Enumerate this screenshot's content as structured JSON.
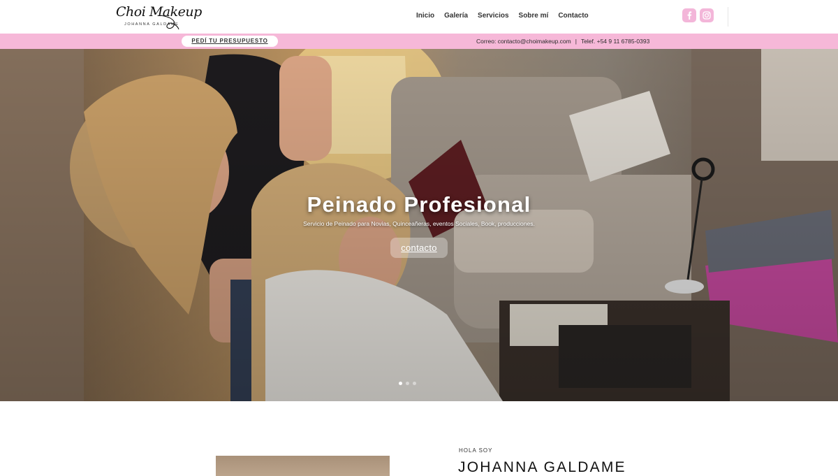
{
  "header": {
    "logo_text": "Choi Makeup",
    "logo_sub": "JOHANNA GALDAME",
    "nav": [
      "Inicio",
      "Galería",
      "Servicios",
      "Sobre mí",
      "Contacto"
    ]
  },
  "social": {
    "facebook_icon": "facebook-icon",
    "instagram_icon": "instagram-icon",
    "color": "#f3b6d9"
  },
  "topbar": {
    "quote_button": "PEDÍ TU PRESUPUESTO",
    "email_text": "Correo: contacto@choimakeup.com",
    "separator": "|",
    "phone_text": "Telef.  +54 9 11 6785-0393",
    "color": "#f6b8d8"
  },
  "hero": {
    "title": "Peinado Profesional",
    "subtitle": "Servicio de Peinado para Novias, Quinceañeras, eventos Sociales, Book, producciones.",
    "button": "contacto",
    "slides_count": 3,
    "active_slide": 1
  },
  "about": {
    "label": "HOLA SOY",
    "name": "JOHANNA GALDAME"
  }
}
